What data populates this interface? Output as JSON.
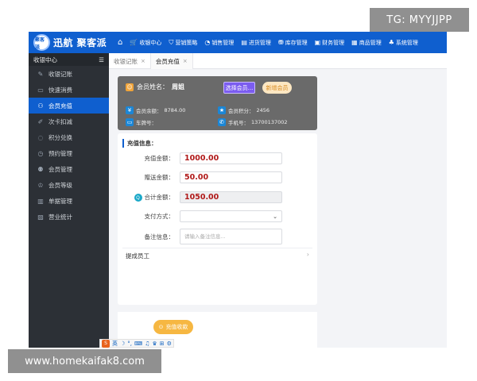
{
  "app": {
    "logo_seal": "聚客派",
    "logo_text": "迅航 聚客派"
  },
  "nav": {
    "home_icon": "home-icon",
    "items": [
      {
        "label": "收银中心",
        "icon": "cart-icon"
      },
      {
        "label": "营销策略",
        "icon": "gift-icon"
      },
      {
        "label": "销售管理",
        "icon": "chart-icon"
      },
      {
        "label": "进货管理",
        "icon": "box-icon"
      },
      {
        "label": "库存管理",
        "icon": "warehouse-icon"
      },
      {
        "label": "财务管理",
        "icon": "money-icon"
      },
      {
        "label": "商品管理",
        "icon": "tag-icon"
      },
      {
        "label": "系统管理",
        "icon": "users-icon"
      }
    ]
  },
  "sidebar": {
    "title": "收银中心",
    "toggle_icon": "menu-icon",
    "items": [
      {
        "label": "收银记账",
        "icon": "edit-icon",
        "active": false
      },
      {
        "label": "快速消费",
        "icon": "receipt-icon",
        "active": false
      },
      {
        "label": "会员充值",
        "icon": "user-icon",
        "active": true
      },
      {
        "label": "次卡扣减",
        "icon": "card-icon",
        "active": false
      },
      {
        "label": "积分兑换",
        "icon": "gift-icon",
        "active": false
      },
      {
        "label": "预约管理",
        "icon": "clock-icon",
        "active": false
      },
      {
        "label": "会员管理",
        "icon": "users-icon",
        "active": false
      },
      {
        "label": "会员等级",
        "icon": "level-icon",
        "active": false
      },
      {
        "label": "单据管理",
        "icon": "document-icon",
        "active": false
      },
      {
        "label": "营业统计",
        "icon": "stats-icon",
        "active": false
      }
    ]
  },
  "tabs": [
    {
      "label": "收银记账",
      "active": false
    },
    {
      "label": "会员充值",
      "active": true
    }
  ],
  "member": {
    "name_label": "会员姓名：",
    "name_value": "周姐",
    "select_button": "选择会员...",
    "new_button": "新增会员",
    "balance_label": "会员余额：",
    "balance_value": "8784.00",
    "points_label": "会员积分：",
    "points_value": "2456",
    "plate_label": "车牌号：",
    "plate_value": "",
    "phone_label": "手机号：",
    "phone_value": "13700137002"
  },
  "recharge": {
    "section_title": "充值信息：",
    "amount_label": "充值金额：",
    "amount_value": "1000.00",
    "bonus_label": "赠送金额：",
    "bonus_value": "50.00",
    "total_label": "合计金额：",
    "total_value": "1050.00",
    "payment_label": "支付方式：",
    "payment_value": "",
    "remark_label": "备注信息：",
    "remark_placeholder": "请输入备注信息...",
    "commission_label": "提成员工"
  },
  "submit": {
    "label": "充值收款",
    "icon": "check-circle-icon"
  },
  "ime": {
    "logo": "S",
    "mode": "英"
  },
  "watermarks": {
    "tg": "TG: MYYJJPP",
    "url": "www.homekaifak8.com"
  }
}
